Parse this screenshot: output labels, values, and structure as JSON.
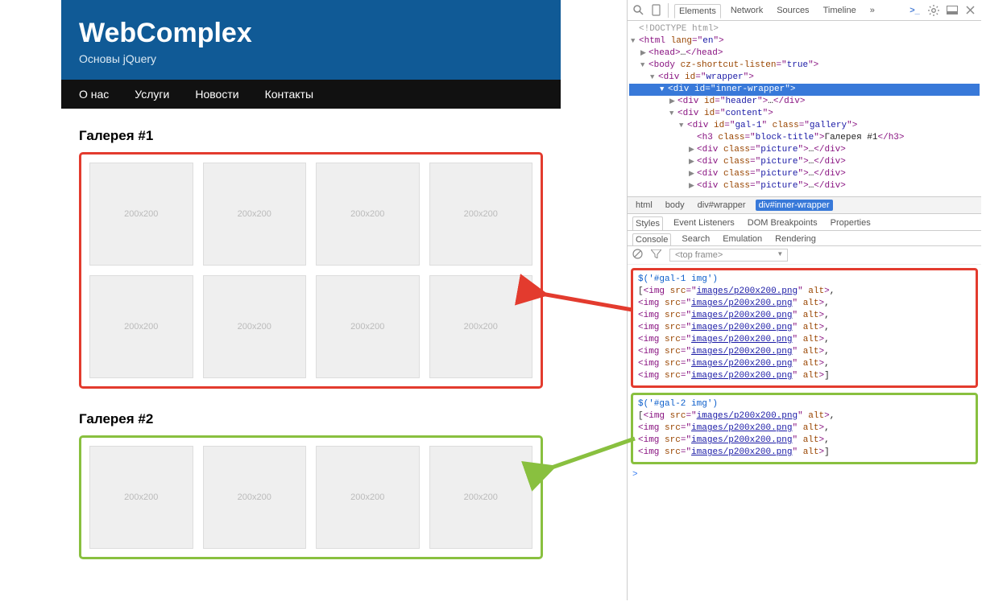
{
  "site": {
    "title": "WebComplex",
    "subtitle": "Основы jQuery",
    "nav": [
      "О нас",
      "Услуги",
      "Новости",
      "Контакты"
    ],
    "gallery1_title": "Галерея #1",
    "gallery2_title": "Галерея #2",
    "placeholder": "200x200"
  },
  "devtools": {
    "tabs": [
      "Elements",
      "Network",
      "Sources",
      "Timeline"
    ],
    "more": "»",
    "dom": {
      "doctype": "<!DOCTYPE html>",
      "html_open": "html",
      "html_lang_attr": "lang",
      "html_lang_val": "en",
      "head": "head",
      "body": "body",
      "body_attr": "cz-shortcut-listen",
      "body_val": "true",
      "wrapper_id": "wrapper",
      "inner_wrapper_id": "inner-wrapper",
      "header_id": "header",
      "content_id": "content",
      "gal1_id": "gal-1",
      "gal_class": "gallery",
      "h3_class": "block-title",
      "h3_text": "Галерея #1",
      "picture_class": "picture"
    },
    "breadcrumb": [
      "html",
      "body",
      "div#wrapper",
      "div#inner-wrapper"
    ],
    "styles_tabs": [
      "Styles",
      "Event Listeners",
      "DOM Breakpoints",
      "Properties"
    ],
    "drawer_tabs": [
      "Console",
      "Search",
      "Emulation",
      "Rendering"
    ],
    "frame": "<top frame>",
    "console": {
      "cmd1": "$('#gal-1 img')",
      "cmd2": "$('#gal-2 img')",
      "img_src": "images/p200x200.png",
      "img_tag": "img",
      "src_attr": "src",
      "alt_attr": "alt",
      "gal1_count": 8,
      "gal2_count": 4
    }
  },
  "colors": {
    "header_blue": "#105a96",
    "red": "#e33b2e",
    "green": "#89c03f",
    "devtools_selection": "#3879d9"
  }
}
